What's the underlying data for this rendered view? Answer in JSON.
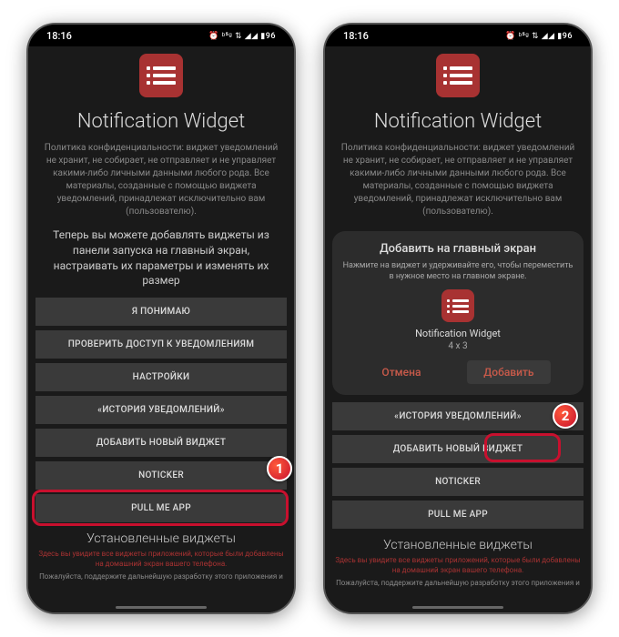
{
  "status": {
    "time": "18:16",
    "icons": "⏰ ᵇ⁵ᵍ ⇅ ◢◢ ▮96"
  },
  "app": {
    "title": "Notification Widget",
    "policy": "Политика конфиденциальности: виджет уведомлений не хранит, не собирает, не отправляет и не управляет какими-либо личными данными любого рода. Все материалы, созданные с помощью виджета уведомлений, принадлежат исключительно вам (пользователю).",
    "intro": "Теперь вы можете добавлять виджеты из панели запуска на главный экран, настраивать их параметры и изменять их размер"
  },
  "buttons": {
    "ok": "Я ПОНИМАЮ",
    "check": "ПРОВЕРИТЬ ДОСТУП К УВЕДОМЛЕНИЯМ",
    "settings": "НАСТРОЙКИ",
    "history": "«ИСТОРИЯ УВЕДОМЛЕНИЙ»",
    "add": "ДОБАВИТЬ НОВЫЙ ВИДЖЕТ",
    "noticker": "NOTICKER",
    "pull": "PULL ME APP"
  },
  "installed": {
    "title": "Установленные виджеты",
    "note": "Здесь вы увидите все виджеты приложений, которые были добавлены на домашний экран вашего телефона.",
    "bottom": "Пожалуйста, поддержите дальнейшую разработку этого приложения и"
  },
  "dialog": {
    "title": "Добавить на главный экран",
    "sub": "Нажмите на виджет и удерживайте его, чтобы переместить в нужное место на главном экране.",
    "name": "Notification Widget",
    "size": "4 x 3",
    "cancel": "Отмена",
    "add": "Добавить"
  },
  "markers": {
    "one": "1",
    "two": "2"
  }
}
